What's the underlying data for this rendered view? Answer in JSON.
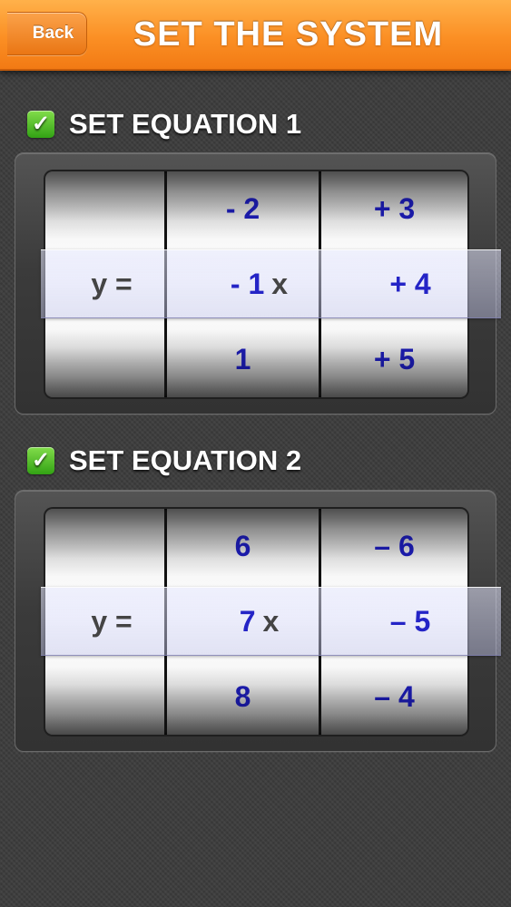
{
  "nav": {
    "back_label": "Back",
    "title": "SET THE SYSTEM"
  },
  "equations": [
    {
      "label": "SET EQUATION 1",
      "prefix": "y  =",
      "x_var": "x",
      "slope_column": [
        "- 2",
        "- 1",
        "1"
      ],
      "intercept_column": [
        "+  3",
        "+  4",
        "+  5"
      ]
    },
    {
      "label": "SET EQUATION 2",
      "prefix": "y  =",
      "x_var": "x",
      "slope_column": [
        "6",
        "7",
        "8"
      ],
      "intercept_column": [
        "–  6",
        "–  5",
        "–  4"
      ]
    }
  ],
  "colors": {
    "nav_orange": "#fb8f24",
    "picker_value_blue": "#1e1ebf",
    "check_green": "#32a214"
  },
  "icons": {
    "checkbox": "check-icon",
    "back": "back-arrow"
  }
}
